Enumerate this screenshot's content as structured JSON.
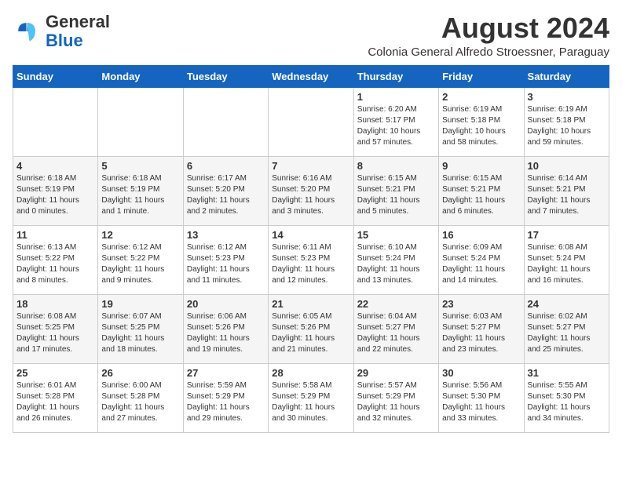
{
  "logo": {
    "general": "General",
    "blue": "Blue"
  },
  "title": {
    "month_year": "August 2024",
    "subtitle": "Colonia General Alfredo Stroessner, Paraguay"
  },
  "weekdays": [
    "Sunday",
    "Monday",
    "Tuesday",
    "Wednesday",
    "Thursday",
    "Friday",
    "Saturday"
  ],
  "weeks": [
    [
      {
        "day": "",
        "info": ""
      },
      {
        "day": "",
        "info": ""
      },
      {
        "day": "",
        "info": ""
      },
      {
        "day": "",
        "info": ""
      },
      {
        "day": "1",
        "info": "Sunrise: 6:20 AM\nSunset: 5:17 PM\nDaylight: 10 hours\nand 57 minutes."
      },
      {
        "day": "2",
        "info": "Sunrise: 6:19 AM\nSunset: 5:18 PM\nDaylight: 10 hours\nand 58 minutes."
      },
      {
        "day": "3",
        "info": "Sunrise: 6:19 AM\nSunset: 5:18 PM\nDaylight: 10 hours\nand 59 minutes."
      }
    ],
    [
      {
        "day": "4",
        "info": "Sunrise: 6:18 AM\nSunset: 5:19 PM\nDaylight: 11 hours\nand 0 minutes."
      },
      {
        "day": "5",
        "info": "Sunrise: 6:18 AM\nSunset: 5:19 PM\nDaylight: 11 hours\nand 1 minute."
      },
      {
        "day": "6",
        "info": "Sunrise: 6:17 AM\nSunset: 5:20 PM\nDaylight: 11 hours\nand 2 minutes."
      },
      {
        "day": "7",
        "info": "Sunrise: 6:16 AM\nSunset: 5:20 PM\nDaylight: 11 hours\nand 3 minutes."
      },
      {
        "day": "8",
        "info": "Sunrise: 6:15 AM\nSunset: 5:21 PM\nDaylight: 11 hours\nand 5 minutes."
      },
      {
        "day": "9",
        "info": "Sunrise: 6:15 AM\nSunset: 5:21 PM\nDaylight: 11 hours\nand 6 minutes."
      },
      {
        "day": "10",
        "info": "Sunrise: 6:14 AM\nSunset: 5:21 PM\nDaylight: 11 hours\nand 7 minutes."
      }
    ],
    [
      {
        "day": "11",
        "info": "Sunrise: 6:13 AM\nSunset: 5:22 PM\nDaylight: 11 hours\nand 8 minutes."
      },
      {
        "day": "12",
        "info": "Sunrise: 6:12 AM\nSunset: 5:22 PM\nDaylight: 11 hours\nand 9 minutes."
      },
      {
        "day": "13",
        "info": "Sunrise: 6:12 AM\nSunset: 5:23 PM\nDaylight: 11 hours\nand 11 minutes."
      },
      {
        "day": "14",
        "info": "Sunrise: 6:11 AM\nSunset: 5:23 PM\nDaylight: 11 hours\nand 12 minutes."
      },
      {
        "day": "15",
        "info": "Sunrise: 6:10 AM\nSunset: 5:24 PM\nDaylight: 11 hours\nand 13 minutes."
      },
      {
        "day": "16",
        "info": "Sunrise: 6:09 AM\nSunset: 5:24 PM\nDaylight: 11 hours\nand 14 minutes."
      },
      {
        "day": "17",
        "info": "Sunrise: 6:08 AM\nSunset: 5:24 PM\nDaylight: 11 hours\nand 16 minutes."
      }
    ],
    [
      {
        "day": "18",
        "info": "Sunrise: 6:08 AM\nSunset: 5:25 PM\nDaylight: 11 hours\nand 17 minutes."
      },
      {
        "day": "19",
        "info": "Sunrise: 6:07 AM\nSunset: 5:25 PM\nDaylight: 11 hours\nand 18 minutes."
      },
      {
        "day": "20",
        "info": "Sunrise: 6:06 AM\nSunset: 5:26 PM\nDaylight: 11 hours\nand 19 minutes."
      },
      {
        "day": "21",
        "info": "Sunrise: 6:05 AM\nSunset: 5:26 PM\nDaylight: 11 hours\nand 21 minutes."
      },
      {
        "day": "22",
        "info": "Sunrise: 6:04 AM\nSunset: 5:27 PM\nDaylight: 11 hours\nand 22 minutes."
      },
      {
        "day": "23",
        "info": "Sunrise: 6:03 AM\nSunset: 5:27 PM\nDaylight: 11 hours\nand 23 minutes."
      },
      {
        "day": "24",
        "info": "Sunrise: 6:02 AM\nSunset: 5:27 PM\nDaylight: 11 hours\nand 25 minutes."
      }
    ],
    [
      {
        "day": "25",
        "info": "Sunrise: 6:01 AM\nSunset: 5:28 PM\nDaylight: 11 hours\nand 26 minutes."
      },
      {
        "day": "26",
        "info": "Sunrise: 6:00 AM\nSunset: 5:28 PM\nDaylight: 11 hours\nand 27 minutes."
      },
      {
        "day": "27",
        "info": "Sunrise: 5:59 AM\nSunset: 5:29 PM\nDaylight: 11 hours\nand 29 minutes."
      },
      {
        "day": "28",
        "info": "Sunrise: 5:58 AM\nSunset: 5:29 PM\nDaylight: 11 hours\nand 30 minutes."
      },
      {
        "day": "29",
        "info": "Sunrise: 5:57 AM\nSunset: 5:29 PM\nDaylight: 11 hours\nand 32 minutes."
      },
      {
        "day": "30",
        "info": "Sunrise: 5:56 AM\nSunset: 5:30 PM\nDaylight: 11 hours\nand 33 minutes."
      },
      {
        "day": "31",
        "info": "Sunrise: 5:55 AM\nSunset: 5:30 PM\nDaylight: 11 hours\nand 34 minutes."
      }
    ]
  ]
}
